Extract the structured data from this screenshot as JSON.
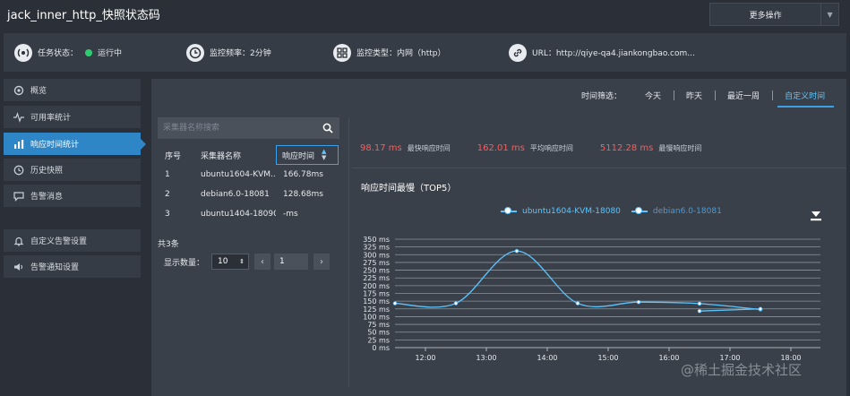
{
  "app": {
    "title": "jack_inner_http_快照状态码",
    "more_label": "更多操作"
  },
  "infobar": {
    "task_status_label": "任务状态：",
    "task_status_value": "运行中",
    "frequency": "监控频率：2分钟",
    "type": "监控类型：内网（http）",
    "url": "URL：http://qiye-qa4.jiankongbao.com..."
  },
  "sidebar": {
    "items": [
      {
        "label": "概览",
        "icon": "overview-icon"
      },
      {
        "label": "可用率统计",
        "icon": "pulse-icon"
      },
      {
        "label": "响应时间统计",
        "icon": "bar-chart-icon"
      },
      {
        "label": "历史快照",
        "icon": "history-icon"
      },
      {
        "label": "告警消息",
        "icon": "message-icon"
      },
      {
        "label": "自定义告警设置",
        "icon": "bell-icon"
      },
      {
        "label": "告警通知设置",
        "icon": "speaker-icon"
      }
    ],
    "active_index": 2
  },
  "time_filter": {
    "label": "时间筛选：",
    "options": [
      "今天",
      "昨天",
      "最近一周",
      "自定义时间"
    ],
    "selected": "自定义时间"
  },
  "search": {
    "placeholder": "采集器名称搜索"
  },
  "table": {
    "headers": [
      "序号",
      "采集器名称",
      "响应时间"
    ],
    "rows": [
      {
        "idx": "1",
        "name": "ubuntu1604-KVM...",
        "time": "166.78ms"
      },
      {
        "idx": "2",
        "name": "debian6.0-18081",
        "time": "128.68ms"
      },
      {
        "idx": "3",
        "name": "ubuntu1404-18090",
        "time": "-ms"
      }
    ],
    "total": "共3条",
    "page_size_label": "显示数量：",
    "page_size": "10",
    "page": "1"
  },
  "stats": [
    {
      "value": "98.17 ms",
      "label": "最快响应时间"
    },
    {
      "value": "162.01 ms",
      "label": "平均响应时间"
    },
    {
      "value": "5112.28 ms",
      "label": "最慢响应时间"
    }
  ],
  "colors": {
    "accent": "#2f86c6",
    "line": "#5cc5ff",
    "stat_value": "#ff5a5a",
    "status_ok": "#2ecc71"
  },
  "watermark": "@稀土掘金技术社区",
  "chart_data": {
    "type": "line",
    "title": "响应时间最慢（TOP5）",
    "x": [
      "12:00",
      "13:00",
      "14:00",
      "15:00",
      "16:00",
      "17:00",
      "18:00"
    ],
    "ylim": [
      0,
      350
    ],
    "yticks": [
      0,
      25,
      50,
      75,
      100,
      125,
      150,
      175,
      200,
      225,
      250,
      275,
      300,
      325,
      350
    ],
    "ytick_labels": [
      "0 ms",
      "25 ms",
      "50 ms",
      "75 ms",
      "100 ms",
      "125 ms",
      "150 ms",
      "175 ms",
      "200 ms",
      "225 ms",
      "250 ms",
      "275 ms",
      "300 ms",
      "325 ms",
      "350 ms"
    ],
    "grid": true,
    "legend_position": "top",
    "series": [
      {
        "name": "ubuntu1604-KVM-18080",
        "points": [
          {
            "x": 11.5,
            "y": 143
          },
          {
            "x": 12.5,
            "y": 143
          },
          {
            "x": 13.5,
            "y": 312
          },
          {
            "x": 14.5,
            "y": 143
          },
          {
            "x": 15.5,
            "y": 147
          },
          {
            "x": 16.5,
            "y": 142
          },
          {
            "x": 17.5,
            "y": 123
          }
        ]
      },
      {
        "name": "debian6.0-18081",
        "points": [
          {
            "x": 16.5,
            "y": 118
          },
          {
            "x": 17.5,
            "y": 125
          }
        ]
      }
    ]
  }
}
